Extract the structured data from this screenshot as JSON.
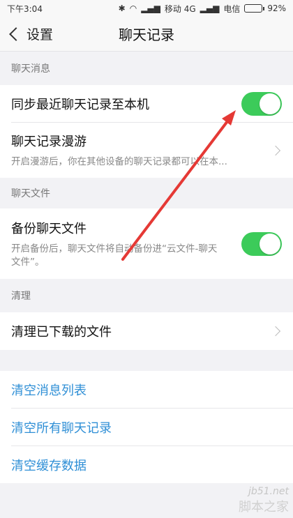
{
  "status": {
    "time": "下午3:04",
    "carrier1": "移动 4G",
    "carrier2": "电信",
    "battery": "92%",
    "battery_level": 0.92
  },
  "nav": {
    "back_label": "设置",
    "title": "聊天记录"
  },
  "sections": {
    "chat_messages": {
      "header": "聊天消息",
      "sync": {
        "title": "同步最近聊天记录至本机",
        "enabled": true
      },
      "roaming": {
        "title": "聊天记录漫游",
        "desc": "开启漫游后，你在其他设备的聊天记录都可以在本..."
      }
    },
    "chat_files": {
      "header": "聊天文件",
      "backup": {
        "title": "备份聊天文件",
        "desc": "开启备份后，聊天文件将自动备份进“云文件-聊天文件”。",
        "enabled": true
      }
    },
    "cleanup": {
      "header": "清理",
      "clean_downloads": {
        "title": "清理已下载的文件"
      }
    },
    "actions": {
      "clear_messages": "清空消息列表",
      "clear_all_chats": "清空所有聊天记录",
      "clear_cache": "清空缓存数据"
    }
  },
  "watermark": {
    "url": "jb51.net",
    "brand": "脚本之家"
  },
  "colors": {
    "toggle_on": "#3ccb5a",
    "link": "#2f8fd6",
    "annotation_arrow": "#e53935"
  }
}
